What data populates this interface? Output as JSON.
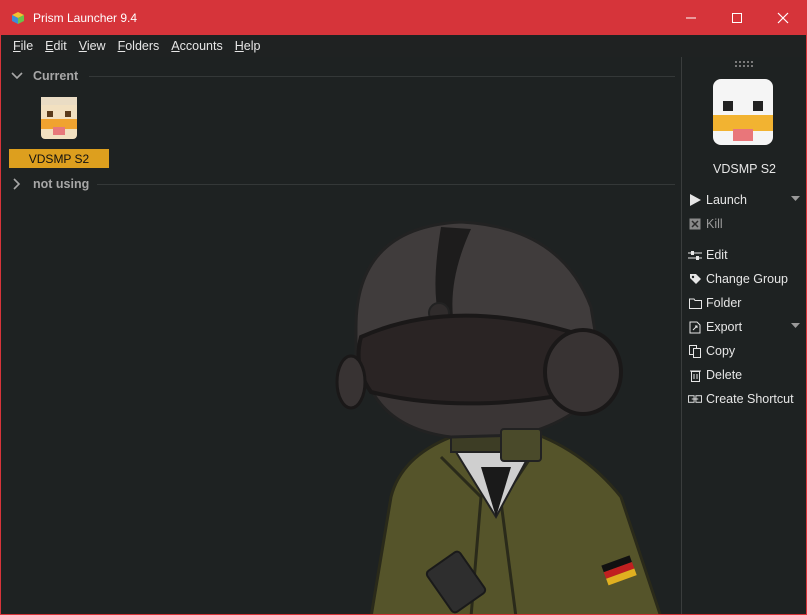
{
  "window": {
    "title": "Prism Launcher 9.4"
  },
  "menu": [
    {
      "label": "File",
      "underline": "F",
      "rest": "ile"
    },
    {
      "label": "Edit",
      "underline": "E",
      "rest": "dit"
    },
    {
      "label": "View",
      "underline": "V",
      "rest": "iew"
    },
    {
      "label": "Folders",
      "underline": "F",
      "rest": "olders"
    },
    {
      "label": "Accounts",
      "underline": "A",
      "rest": "ccounts"
    },
    {
      "label": "Help",
      "underline": "H",
      "rest": "elp"
    }
  ],
  "groups": [
    {
      "name": "Current",
      "expanded": true
    },
    {
      "name": "not using",
      "expanded": false
    }
  ],
  "instance": {
    "name": "VDSMP S2"
  },
  "panel": {
    "instance_name": "VDSMP S2",
    "actions": {
      "launch": "Launch",
      "kill": "Kill",
      "edit": "Edit",
      "change_group": "Change Group",
      "folder": "Folder",
      "export": "Export",
      "copy": "Copy",
      "delete": "Delete",
      "create_shortcut": "Create Shortcut"
    }
  },
  "colors": {
    "titlebar": "#d6343a",
    "selection": "#dd9f1e",
    "background": "#1e2222"
  }
}
